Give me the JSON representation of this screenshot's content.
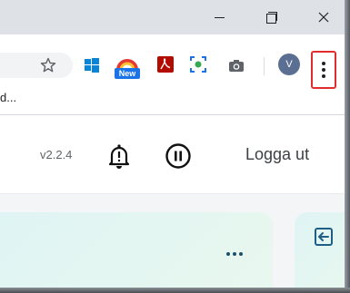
{
  "browser": {
    "window_controls": {
      "minimize": "minimize-icon",
      "maximize": "restore-icon",
      "close": "close-icon"
    },
    "bookmark_bar": {
      "truncated_item": "d..."
    },
    "toolbar": {
      "extensions": [
        {
          "name": "windows-icon"
        },
        {
          "name": "new-extension-icon",
          "badge": "New"
        },
        {
          "name": "acrobat-icon"
        },
        {
          "name": "screen-capture-icon"
        },
        {
          "name": "camera-icon"
        }
      ],
      "profile_initial": "V",
      "menu_icon": "more-vert-icon"
    }
  },
  "app_header": {
    "version": "v2.2.4",
    "notifications_icon": "bell-alert-icon",
    "pause_icon": "pause-circle-icon",
    "logout_label": "Logga ut"
  },
  "cards": [
    {
      "menu_icon": "more-horiz-icon"
    },
    {
      "icon": "login-icon"
    }
  ],
  "colors": {
    "menu_highlight": "#e22b2b",
    "avatar": "#5b6f92",
    "card_gradient_start": "#dff4f4",
    "card_gradient_end": "#e9f8ef"
  }
}
